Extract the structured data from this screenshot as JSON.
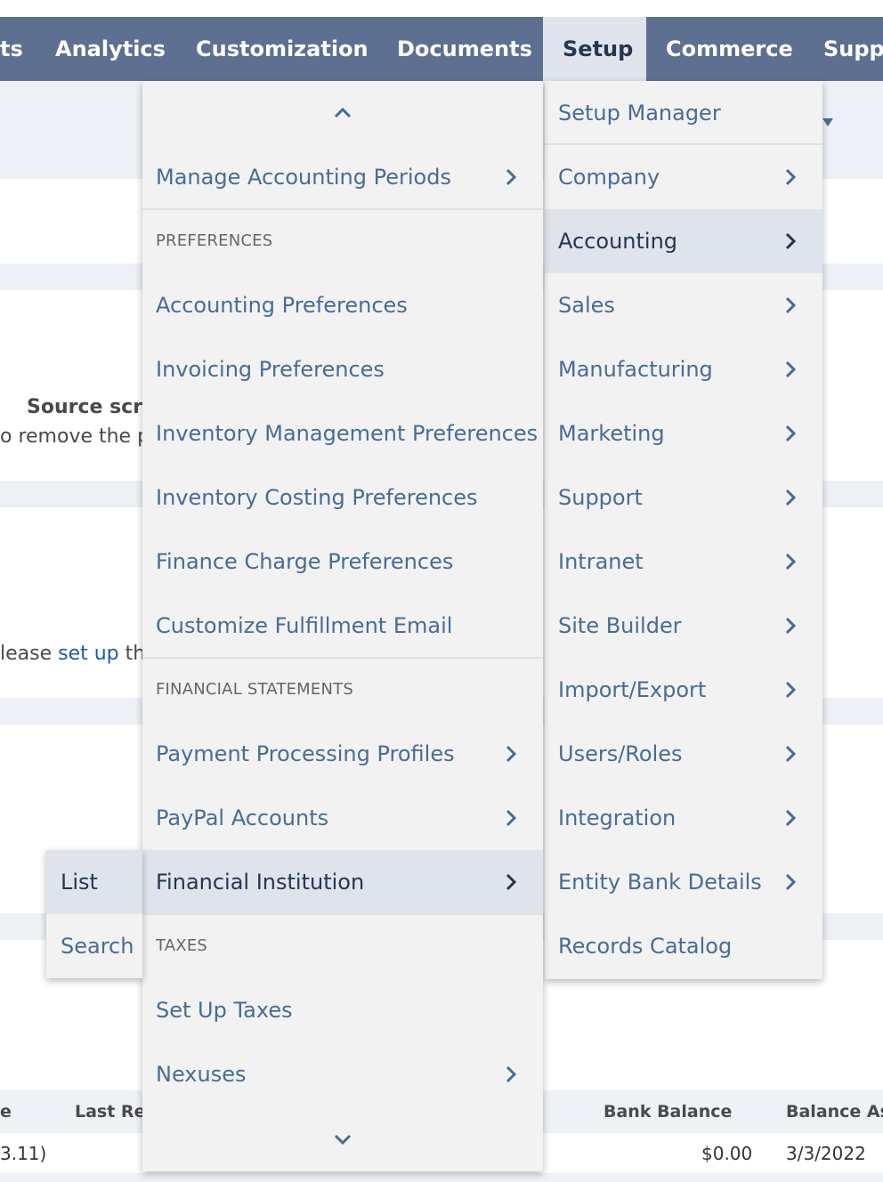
{
  "nav": {
    "items": [
      {
        "label": "ts"
      },
      {
        "label": "Analytics"
      },
      {
        "label": "Customization"
      },
      {
        "label": "Documents"
      },
      {
        "label": "Setup",
        "active": true
      },
      {
        "label": "Commerce"
      },
      {
        "label": "Supp"
      }
    ]
  },
  "background": {
    "source_script_label": "Source scri",
    "remove_text": "o remove the p",
    "please_prefix": "lease ",
    "setup_link": "set up",
    "please_suffix": " thi",
    "table": {
      "headers": [
        "e",
        "Last Rec",
        "Bank Balance",
        "Balance As"
      ],
      "row": [
        "3.11)",
        "$0.00",
        "3/3/2022"
      ]
    }
  },
  "setup_menu": {
    "items": [
      {
        "label": "Setup Manager",
        "submenu": false
      },
      {
        "label": "Company",
        "submenu": true
      },
      {
        "label": "Accounting",
        "submenu": true,
        "highlighted": true
      },
      {
        "label": "Sales",
        "submenu": true
      },
      {
        "label": "Manufacturing",
        "submenu": true
      },
      {
        "label": "Marketing",
        "submenu": true
      },
      {
        "label": "Support",
        "submenu": true
      },
      {
        "label": "Intranet",
        "submenu": true
      },
      {
        "label": "Site Builder",
        "submenu": true
      },
      {
        "label": "Import/Export",
        "submenu": true
      },
      {
        "label": "Users/Roles",
        "submenu": true
      },
      {
        "label": "Integration",
        "submenu": true
      },
      {
        "label": "Entity Bank Details",
        "submenu": true
      },
      {
        "label": "Records Catalog",
        "submenu": false
      }
    ]
  },
  "accounting_menu": {
    "scroll_up_icon": "chevron-up-icon",
    "scroll_down_icon": "chevron-down-icon",
    "items": [
      {
        "label": "Manage Accounting Periods",
        "submenu": true
      },
      {
        "section": "PREFERENCES"
      },
      {
        "label": "Accounting Preferences"
      },
      {
        "label": "Invoicing Preferences"
      },
      {
        "label": "Inventory Management Preferences"
      },
      {
        "label": "Inventory Costing Preferences"
      },
      {
        "label": "Finance Charge Preferences"
      },
      {
        "label": "Customize Fulfillment Email"
      },
      {
        "section": "FINANCIAL STATEMENTS"
      },
      {
        "label": "Payment Processing Profiles",
        "submenu": true
      },
      {
        "label": "PayPal Accounts",
        "submenu": true
      },
      {
        "label": "Financial Institution",
        "submenu": true,
        "highlighted": true
      },
      {
        "section": "TAXES"
      },
      {
        "label": "Set Up Taxes"
      },
      {
        "label": "Nexuses",
        "submenu": true
      }
    ]
  },
  "fi_submenu": {
    "items": [
      {
        "label": "List",
        "highlighted": true
      },
      {
        "label": "Search"
      }
    ]
  },
  "colors": {
    "nav_bg": "#5e7091",
    "nav_active_bg": "#dfe4ec",
    "menu_bg": "#f2f2f2",
    "menu_text": "#486c95",
    "highlight_bg": "#dfe4ec",
    "highlight_text": "#263650"
  }
}
